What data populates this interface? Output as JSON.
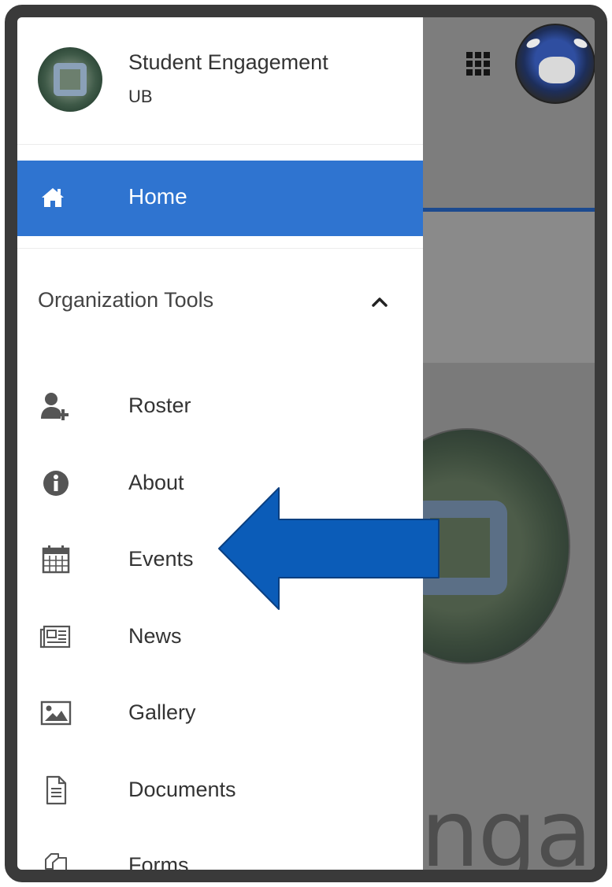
{
  "drawer": {
    "org_name": "Student Engagement",
    "org_sub": "UB",
    "home_label": "Home",
    "section_label": "Organization Tools",
    "items": [
      {
        "label": "Roster",
        "icon": "add-user-icon"
      },
      {
        "label": "About",
        "icon": "info-icon"
      },
      {
        "label": "Events",
        "icon": "calendar-icon"
      },
      {
        "label": "News",
        "icon": "newspaper-icon"
      },
      {
        "label": "Gallery",
        "icon": "image-icon"
      },
      {
        "label": "Documents",
        "icon": "document-icon"
      },
      {
        "label": "Forms",
        "icon": "forms-icon"
      }
    ]
  },
  "background": {
    "partial_word": "ngage"
  },
  "colors": {
    "accent": "#2f74d0",
    "arrow": "#0b5cb8",
    "overlay": "#7d7d7d"
  }
}
